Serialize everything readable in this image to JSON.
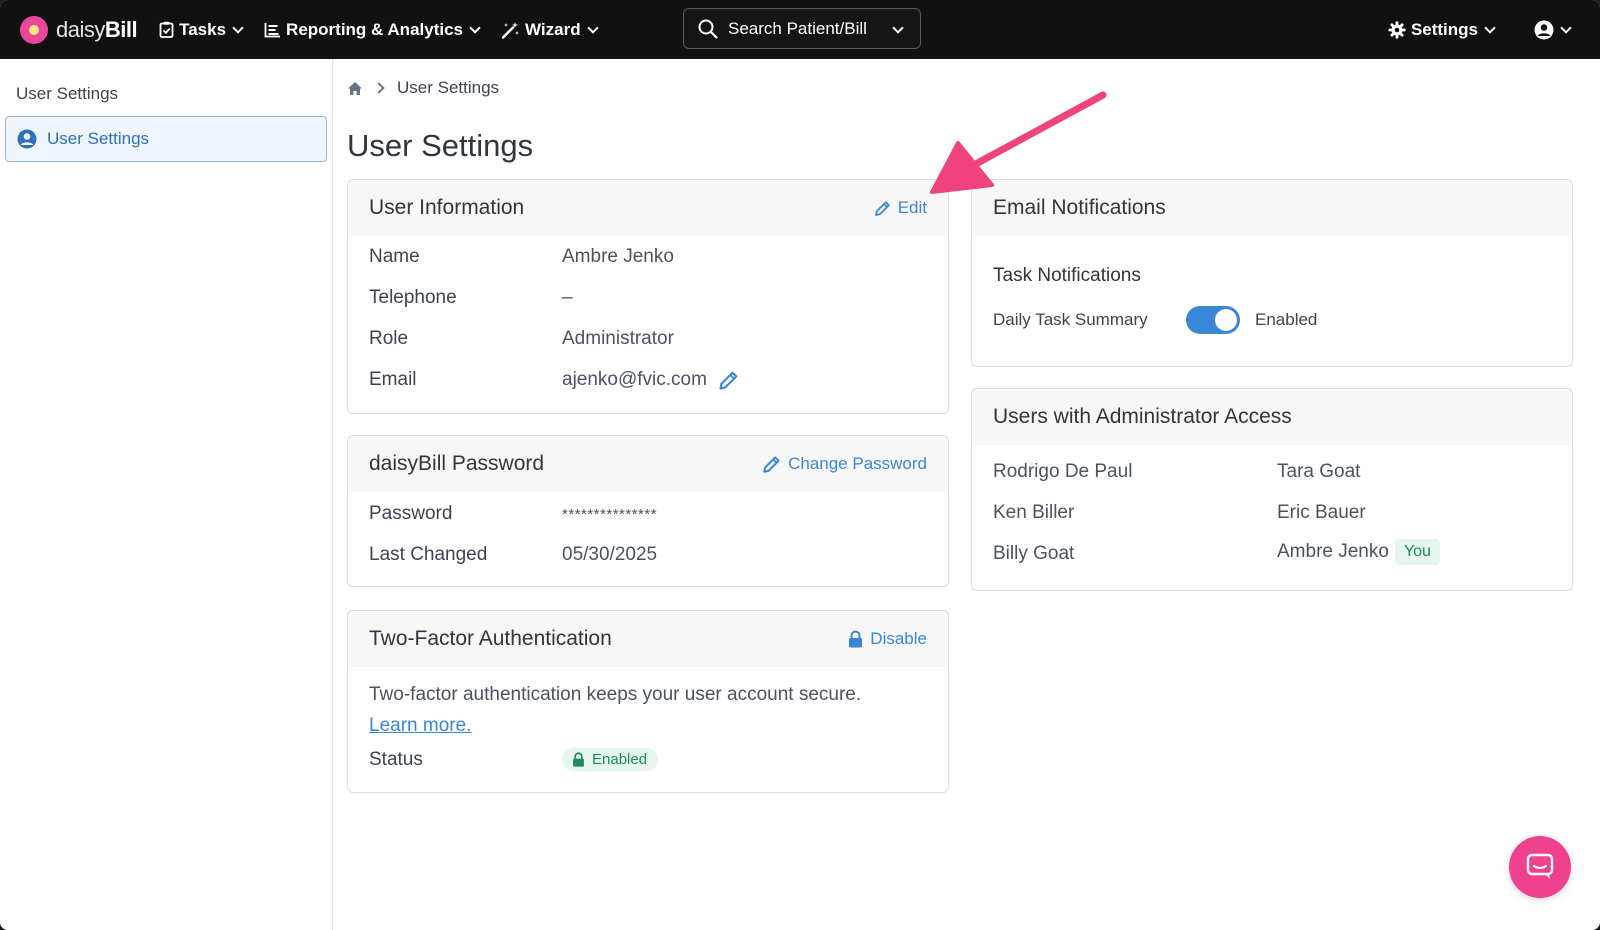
{
  "nav": {
    "logo_light": "daisy",
    "logo_bold": "Bill",
    "tasks": "Tasks",
    "reporting": "Reporting & Analytics",
    "wizard": "Wizard",
    "search": "Search Patient/Bill",
    "settings": "Settings"
  },
  "sidebar": {
    "title": "User Settings",
    "items": [
      {
        "label": "User Settings"
      }
    ]
  },
  "breadcrumb": {
    "current": "User Settings"
  },
  "page_title": "User Settings",
  "user_info": {
    "title": "User Information",
    "edit": "Edit",
    "rows": [
      {
        "key": "Name",
        "value": "Ambre Jenko"
      },
      {
        "key": "Telephone",
        "value": "–"
      },
      {
        "key": "Role",
        "value": "Administrator"
      },
      {
        "key": "Email",
        "value": "ajenko@fvic.com"
      }
    ]
  },
  "password": {
    "title": "daisyBill Password",
    "change": "Change Password",
    "password_label": "Password",
    "password_value": "***************",
    "changed_label": "Last Changed",
    "changed_value": "05/30/2025"
  },
  "twofa": {
    "title": "Two-Factor Authentication",
    "disable": "Disable",
    "description": "Two-factor authentication keeps your user account secure.",
    "learn_more": "Learn more.",
    "status_label": "Status",
    "status_value": "Enabled"
  },
  "email_notifications": {
    "title": "Email Notifications",
    "subhead": "Task Notifications",
    "daily_label": "Daily Task Summary",
    "daily_state": "Enabled",
    "daily_enabled": true
  },
  "admins": {
    "title": "Users with Administrator Access",
    "users": [
      "Rodrigo De Paul",
      "Tara Goat",
      "Ken Biller",
      "Eric Bauer",
      "Billy Goat",
      "Ambre Jenko"
    ],
    "you_badge": "You"
  },
  "colors": {
    "accent": "#3b86d6",
    "annotation_arrow": "#f0427e",
    "success": "#1f8a5b",
    "chat": "#f0428c"
  }
}
